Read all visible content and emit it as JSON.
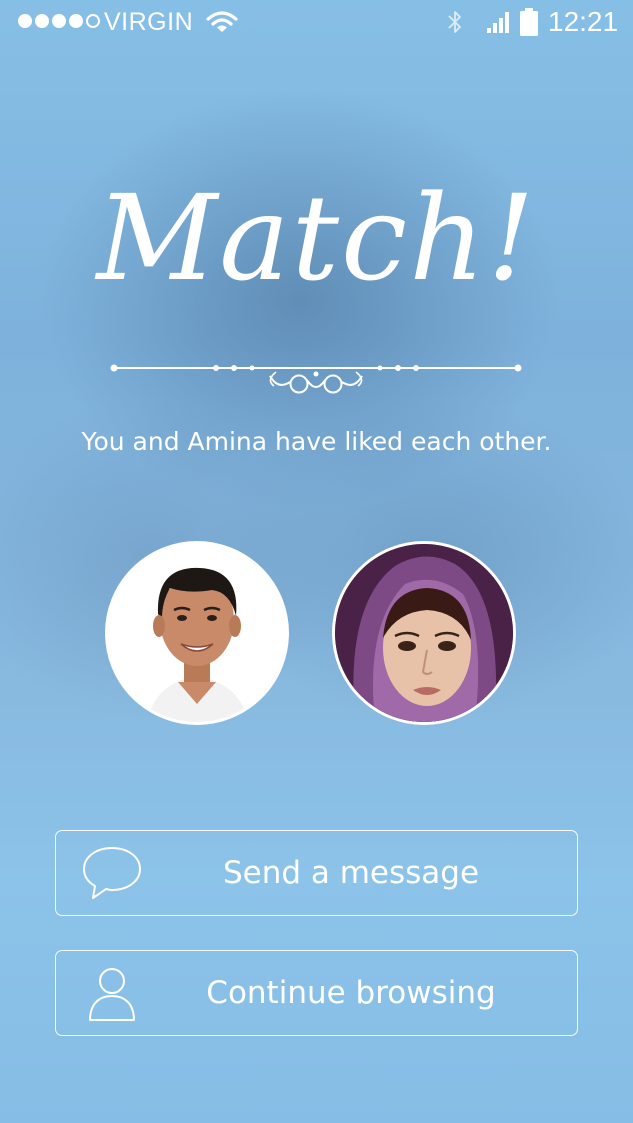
{
  "status_bar": {
    "carrier": "VIRGIN",
    "time": "12:21",
    "signal_filled": 4,
    "signal_total": 5,
    "icons": [
      "wifi-icon",
      "bluetooth-icon",
      "cellular-signal-icon",
      "battery-icon"
    ]
  },
  "match": {
    "title": "Match!",
    "message": "You and Amina have liked each other."
  },
  "avatars": {
    "user": "user-avatar",
    "match": "match-avatar"
  },
  "actions": {
    "send_message": {
      "label": "Send a message",
      "icon": "chat-bubble-icon"
    },
    "continue_browsing": {
      "label": "Continue browsing",
      "icon": "person-icon"
    }
  },
  "colors": {
    "background": "#86bde3",
    "foreground": "#ffffff"
  }
}
